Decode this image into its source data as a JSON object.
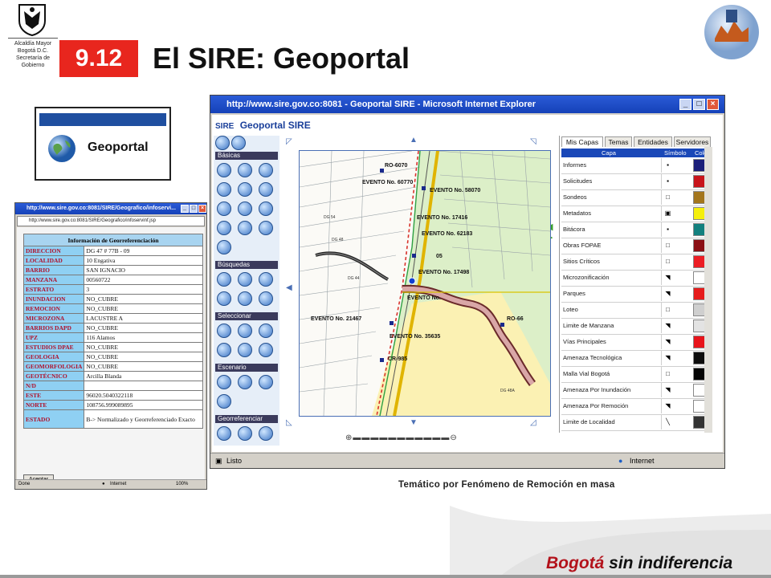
{
  "header": {
    "seal_lines": [
      "Alcaldía Mayor",
      "Bogotá D.C.",
      "Secretaría de",
      "Gobierno"
    ],
    "section_number": "9.12",
    "title": "El SIRE: Geoportal"
  },
  "geo_thumb": {
    "label": "Geoportal"
  },
  "info_window": {
    "title": "http://www.sire.gov.co:8081/SIRE/Geografico/infoservi...",
    "address": "http://www.sire.gov.co:8081/SIRE/Geografico/infoservinf.jsp",
    "table_title": "Información de Georreferenciación",
    "rows": [
      {
        "k": "DIRECCION",
        "v": "DG 47 # 77B - 09"
      },
      {
        "k": "LOCALIDAD",
        "v": "10 Engativa"
      },
      {
        "k": "BARRIO",
        "v": "SAN IGNACIO"
      },
      {
        "k": "MANZANA",
        "v": "00560722"
      },
      {
        "k": "ESTRATO",
        "v": "3"
      },
      {
        "k": "INUNDACION",
        "v": "NO_CUBRE"
      },
      {
        "k": "REMOCION",
        "v": "NO_CUBRE"
      },
      {
        "k": "MICROZONA",
        "v": "LACUSTRE A"
      },
      {
        "k": "BARRIOS DAPD",
        "v": "NO_CUBRE"
      },
      {
        "k": "UPZ",
        "v": "116 Alamos"
      },
      {
        "k": "ESTUDIOS DPAE",
        "v": "NO_CUBRE"
      },
      {
        "k": "GEOLOGIA",
        "v": "NO_CUBRE"
      },
      {
        "k": "GEOMORFOLOGIA",
        "v": "NO_CUBRE"
      },
      {
        "k": "GEOTÉCNICO",
        "v": "Arcilla Blanda"
      },
      {
        "k": "N/D",
        "v": ""
      },
      {
        "k": "ESTE",
        "v": "96020.5040322118"
      },
      {
        "k": "NORTE",
        "v": "108756.999089895"
      },
      {
        "k": "ESTADO",
        "v": "B-> Normalizado y Georreferenciado Exacto"
      }
    ],
    "accept_label": "Aceptar",
    "status_left": "Done",
    "status_zone": "Internet",
    "status_zoom": "100%"
  },
  "main_window": {
    "title": "http://www.sire.gov.co:8081 - Geoportal SIRE - Microsoft Internet Explorer",
    "portal_brand": "SIRE",
    "portal_title": "Geoportal SIRE",
    "tool_sections": [
      "Básicas",
      "Búsquedas",
      "Seleccionar",
      "Escenario",
      "Georreferenciar"
    ],
    "map_labels": [
      "RO-6070",
      "EVENTO No. 60770",
      "EVENTO No. 58070",
      "EVENTO No. 17416",
      "EVENTO No. 62183",
      "05",
      "EVENTO No. 17498",
      "EVENTO No.",
      "EVENTO No. 21467",
      "RO-66",
      "EVENTO No. 35635",
      "CR-985"
    ],
    "tabs": [
      "Mis Capas",
      "Temas",
      "Entidades",
      "Servidores"
    ],
    "layer_columns": [
      "Capa",
      "Símbolo",
      "Color"
    ],
    "layers": [
      {
        "name": "Informes",
        "color": "#1b1f7a",
        "symbol": "▪"
      },
      {
        "name": "Solicitudes",
        "color": "#c8141b",
        "symbol": "▪"
      },
      {
        "name": "Sondeos",
        "color": "#a3761d",
        "symbol": "□"
      },
      {
        "name": "Metadatos",
        "color": "#f5ef0c",
        "symbol": "▣"
      },
      {
        "name": "Bitácora",
        "color": "#12807e",
        "symbol": "▪"
      },
      {
        "name": "Obras FOPAE",
        "color": "#8b0f14",
        "symbol": "□"
      },
      {
        "name": "Sitios Críticos",
        "color": "#ec1d24",
        "symbol": "□"
      },
      {
        "name": "Microzonificación",
        "color": "#ffffff",
        "symbol": "◥"
      },
      {
        "name": "Parques",
        "color": "#e61c1c",
        "symbol": "◥"
      },
      {
        "name": "Loteo",
        "color": "#cfcfcf",
        "symbol": "□"
      },
      {
        "name": "Limite de Manzana",
        "color": "#e3e3e3",
        "symbol": "◥"
      },
      {
        "name": "Vías Principales",
        "color": "#e8141b",
        "symbol": "◥"
      },
      {
        "name": "Amenaza Tecnológica",
        "color": "#0d0d0d",
        "symbol": "◥"
      },
      {
        "name": "Malla Vial Bogotá",
        "color": "#050505",
        "symbol": "□"
      },
      {
        "name": "Amenaza Por Inundación",
        "color": "#ffffff",
        "symbol": "◥"
      },
      {
        "name": "Amenaza Por Remoción",
        "color": "#ffffff",
        "symbol": "◥"
      },
      {
        "name": "Limite de Localidad",
        "color": "#333333",
        "symbol": "╲"
      }
    ],
    "status_left": "Listo",
    "status_zone": "Internet"
  },
  "caption": "Temático por Fenómeno de  Remoción en masa",
  "footer": {
    "brand_a": "Bogotá",
    "brand_b": "sin indiferencia"
  },
  "colors": {
    "accent_red": "#e8261e",
    "ie_blue": "#1541b8",
    "map_green": "#d9f0c4",
    "map_yellow": "#fbf3b8"
  }
}
